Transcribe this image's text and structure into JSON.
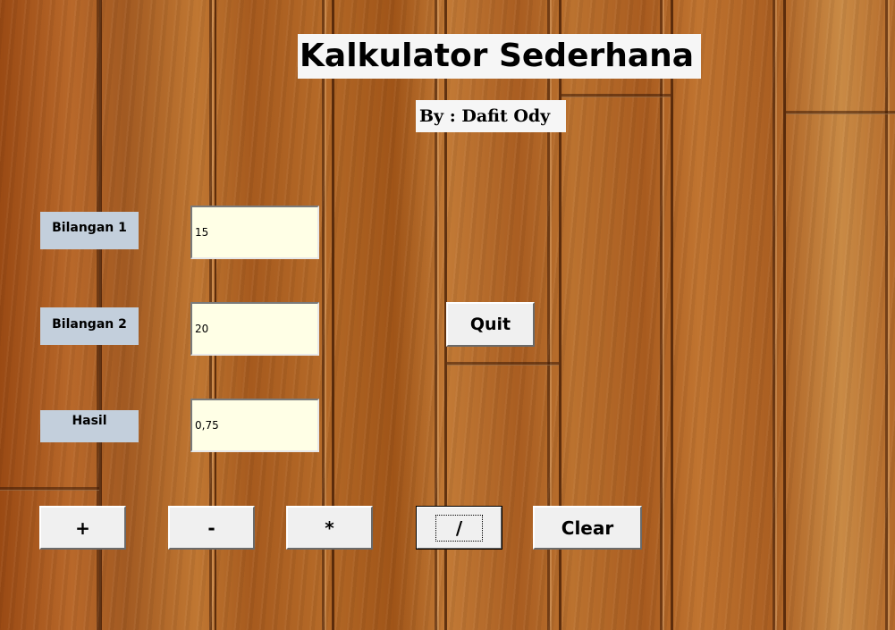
{
  "app": {
    "title": "Kalkulator Sederhana",
    "subtitle": "By : Dafit Ody"
  },
  "fields": {
    "bilangan1": {
      "label": "Bilangan 1",
      "value": "15"
    },
    "bilangan2": {
      "label": "Bilangan 2",
      "value": "20"
    },
    "hasil": {
      "label": "Hasil",
      "value": "0,75"
    }
  },
  "buttons": {
    "quit": "Quit",
    "add": "+",
    "subtract": "-",
    "multiply": "*",
    "divide": "/",
    "clear": "Clear"
  },
  "colors": {
    "label_bg": "#c3cfdc",
    "field_bg": "#ffffe6",
    "button_bg": "#f0f0f0",
    "title_bg": "#f6f6f6",
    "wood": "#b0642a"
  }
}
